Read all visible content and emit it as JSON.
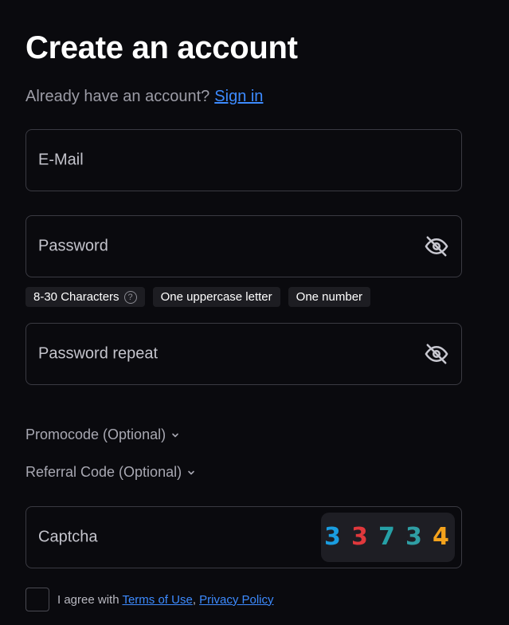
{
  "form": {
    "title": "Create an account",
    "signin_prompt": "Already have an account?",
    "signin_link": "Sign in"
  },
  "fields": {
    "email": {
      "label": "E-Mail",
      "value": ""
    },
    "password": {
      "label": "Password",
      "value": "",
      "toggle_icon": "eye-slash-icon"
    },
    "password_repeat": {
      "label": "Password repeat",
      "value": "",
      "toggle_icon": "eye-slash-icon"
    },
    "captcha": {
      "label": "Captcha",
      "value": ""
    }
  },
  "password_requirements": [
    {
      "label": "8-30 Characters",
      "help_icon": "question-circle-icon",
      "help_glyph": "?"
    },
    {
      "label": "One uppercase letter"
    },
    {
      "label": "One number"
    }
  ],
  "optional_sections": {
    "promocode": {
      "label": "Promocode (Optional)",
      "icon": "chevron-down-icon"
    },
    "referral": {
      "label": "Referral Code (Optional)",
      "icon": "chevron-down-icon"
    }
  },
  "captcha_image": {
    "digits": [
      {
        "char": "3",
        "color": "#1a9de0"
      },
      {
        "char": "3",
        "color": "#e0383c"
      },
      {
        "char": "7",
        "color": "#26a0a6"
      },
      {
        "char": "3",
        "color": "#2f9ea4"
      },
      {
        "char": "4",
        "color": "#f4a21c"
      }
    ]
  },
  "agreement": {
    "prefix": "I agree with",
    "terms_link": "Terms of Use",
    "separator": ",",
    "privacy_link": "Privacy Policy",
    "checked": false
  },
  "colors": {
    "background": "#0a0a0e",
    "border": "#3a3a42",
    "link": "#3d8bff",
    "chip_background": "#1d1d22"
  }
}
